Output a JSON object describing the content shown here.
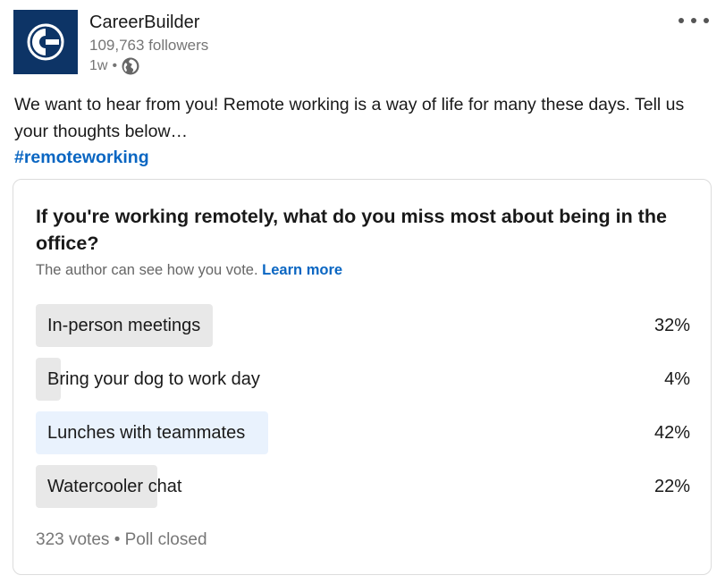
{
  "author": {
    "name": "CareerBuilder",
    "followers": "109,763 followers",
    "time": "1w",
    "separator": "•",
    "visibility_icon": "globe-icon",
    "logo_color": "#0d3466"
  },
  "post": {
    "commentary": "We want to hear from you! Remote working is a way of life for many these days. Tell us your thoughts below…",
    "hashtag": "#remoteworking"
  },
  "poll": {
    "question": "If you're working remotely, what do you miss most about being in the office?",
    "notice": "The author can see how you vote.",
    "learn_more": "Learn more",
    "options": [
      {
        "label": "In-person meetings",
        "percent_label": "32%",
        "percent": 32,
        "selected": false
      },
      {
        "label": "Bring your dog to work day",
        "percent_label": "4%",
        "percent": 4,
        "selected": false
      },
      {
        "label": "Lunches with teammates",
        "percent_label": "42%",
        "percent": 42,
        "selected": true
      },
      {
        "label": "Watercooler chat",
        "percent_label": "22%",
        "percent": 22,
        "selected": false
      }
    ],
    "votes": "323 votes",
    "footer_separator": "•",
    "status": "Poll closed"
  },
  "colors": {
    "link": "#0a66c2",
    "bar": "#e8e8e8",
    "bar_selected": "#e9f2fd"
  }
}
